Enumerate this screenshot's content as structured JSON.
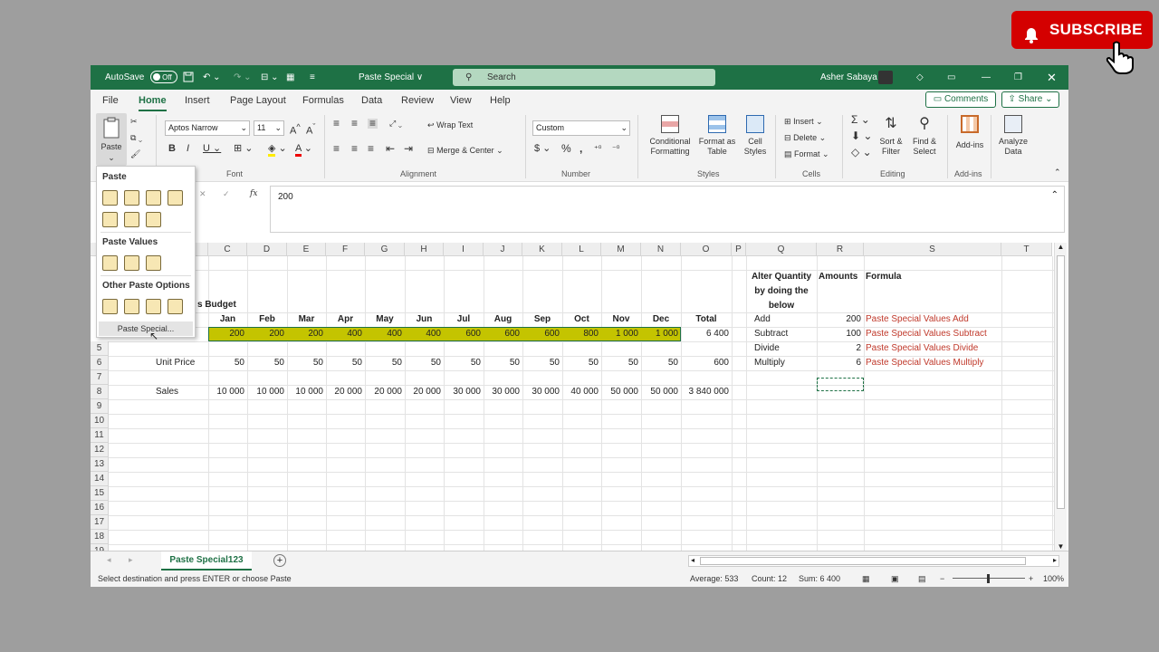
{
  "window": {
    "autosave_label": "AutoSave",
    "autosave_state": "Off",
    "doc_title": "Paste Special ∨",
    "search_placeholder": "Search",
    "user_name": "Asher Sabaya"
  },
  "menu": {
    "tabs": [
      "File",
      "Home",
      "Insert",
      "Page Layout",
      "Formulas",
      "Data",
      "Review",
      "View",
      "Help"
    ],
    "active_tab": "Home",
    "comments_label": "Comments",
    "share_label": "Share"
  },
  "ribbon": {
    "paste_label": "Paste",
    "font_name": "Aptos Narrow",
    "font_size": "11",
    "wrap_text": "Wrap Text",
    "merge_center": "Merge & Center",
    "number_format": "Custom",
    "conditional_formatting": "Conditional Formatting",
    "format_as_table": "Format as Table",
    "cell_styles": "Cell Styles",
    "insert": "Insert",
    "delete": "Delete",
    "format": "Format",
    "sort_filter": "Sort & Filter",
    "find_select": "Find & Select",
    "add_ins": "Add-ins",
    "analyze_data": "Analyze Data",
    "groups": {
      "font": "Font",
      "alignment": "Alignment",
      "number": "Number",
      "styles": "Styles",
      "cells": "Cells",
      "editing": "Editing",
      "add_ins": "Add-ins"
    }
  },
  "formula_bar": {
    "fx": "fx",
    "content": "200"
  },
  "paste_menu": {
    "section_paste": "Paste",
    "section_values": "Paste Values",
    "section_other": "Other Paste Options",
    "paste_special": "Paste Special..."
  },
  "sheet": {
    "columns": [
      "C",
      "D",
      "E",
      "F",
      "G",
      "H",
      "I",
      "J",
      "K",
      "L",
      "M",
      "N",
      "O",
      "P",
      "Q",
      "R",
      "S",
      "T"
    ],
    "rows": [
      "5",
      "6",
      "7",
      "8",
      "9",
      "10",
      "11",
      "12",
      "13",
      "14",
      "15",
      "16",
      "17",
      "18",
      "19"
    ],
    "budget_label": "s Budget",
    "months": [
      "Jan",
      "Feb",
      "Mar",
      "Apr",
      "May",
      "Jun",
      "Jul",
      "Aug",
      "Sep",
      "Oct",
      "Nov",
      "Dec"
    ],
    "total_label": "Total",
    "quantity_row": [
      "200",
      "200",
      "200",
      "400",
      "400",
      "400",
      "600",
      "600",
      "600",
      "800",
      "1 000",
      "1 000"
    ],
    "quantity_total": "6 400",
    "unit_price_label": "Unit Price",
    "unit_price_row": [
      "50",
      "50",
      "50",
      "50",
      "50",
      "50",
      "50",
      "50",
      "50",
      "50",
      "50",
      "50"
    ],
    "unit_price_total": "600",
    "sales_label": "Sales",
    "sales_row": [
      "10 000",
      "10 000",
      "10 000",
      "20 000",
      "20 000",
      "20 000",
      "30 000",
      "30 000",
      "30 000",
      "40 000",
      "50 000",
      "50 000"
    ],
    "sales_total": "3 840 000",
    "side_table": {
      "header_q_lines": [
        "Alter Quantity",
        "by doing the",
        "below"
      ],
      "header_r": "Amounts",
      "header_s": "Formula",
      "rows": [
        {
          "op": "Add",
          "amount": "200",
          "formula": "Paste Special Values Add"
        },
        {
          "op": "Subtract",
          "amount": "100",
          "formula": "Paste Special Values Subtract"
        },
        {
          "op": "Divide",
          "amount": "2",
          "formula": "Paste Special Values Divide"
        },
        {
          "op": "Multiply",
          "amount": "6",
          "formula": "Paste Special Values Multiply"
        }
      ]
    }
  },
  "tabs": {
    "sheet_name": "Paste Special123"
  },
  "status": {
    "message": "Select destination and press ENTER or choose Paste",
    "average": "Average:  533",
    "count": "Count: 12",
    "sum": "Sum:  6 400",
    "zoom": "100%"
  },
  "overlay": {
    "subscribe": "SUBSCRIBE"
  },
  "colors": {
    "excel_green": "#1e7145",
    "highlight": "#c4c400",
    "formula_red": "#c0392b",
    "subscribe_red": "#d40000"
  }
}
